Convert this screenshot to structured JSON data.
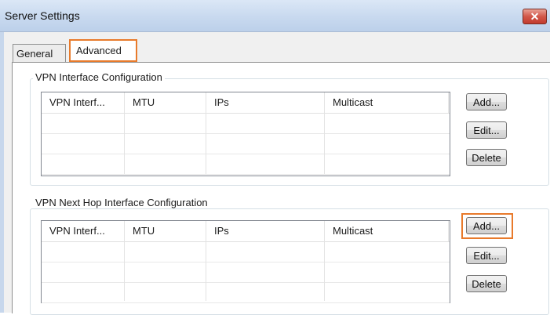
{
  "window": {
    "title": "Server Settings",
    "close_glyph": "✕"
  },
  "tabs": [
    {
      "label": "General",
      "selected": false
    },
    {
      "label": "Advanced",
      "selected": true
    }
  ],
  "groups": [
    {
      "label": "VPN Interface Configuration",
      "columns": [
        "VPN Interf...",
        "MTU",
        "IPs",
        "Multicast"
      ],
      "rows": [],
      "buttons": {
        "add": "Add...",
        "edit": "Edit...",
        "delete": "Delete"
      }
    },
    {
      "label": "VPN Next Hop Interface Configuration",
      "columns": [
        "VPN Interf...",
        "MTU",
        "IPs",
        "Multicast"
      ],
      "rows": [],
      "buttons": {
        "add": "Add...",
        "edit": "Edit...",
        "delete": "Delete"
      }
    }
  ],
  "colors": {
    "highlight": "#e87a2b",
    "title_bar": "#c8d9ef",
    "close_button": "#c23b2e"
  }
}
